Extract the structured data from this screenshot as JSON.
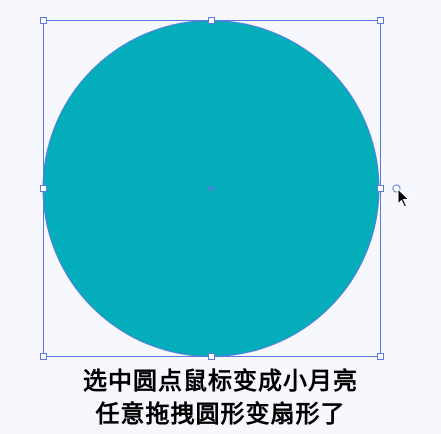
{
  "canvas": {
    "background": "#f7f8fe",
    "circle_fill": "#03adb9",
    "selection_color": "#5b7be0"
  },
  "cursor": {
    "icon": "rotate-arc-cursor-icon"
  },
  "caption": {
    "line1": "选中圆点鼠标变成小月亮",
    "line2": "任意拖拽圆形变扇形了"
  }
}
